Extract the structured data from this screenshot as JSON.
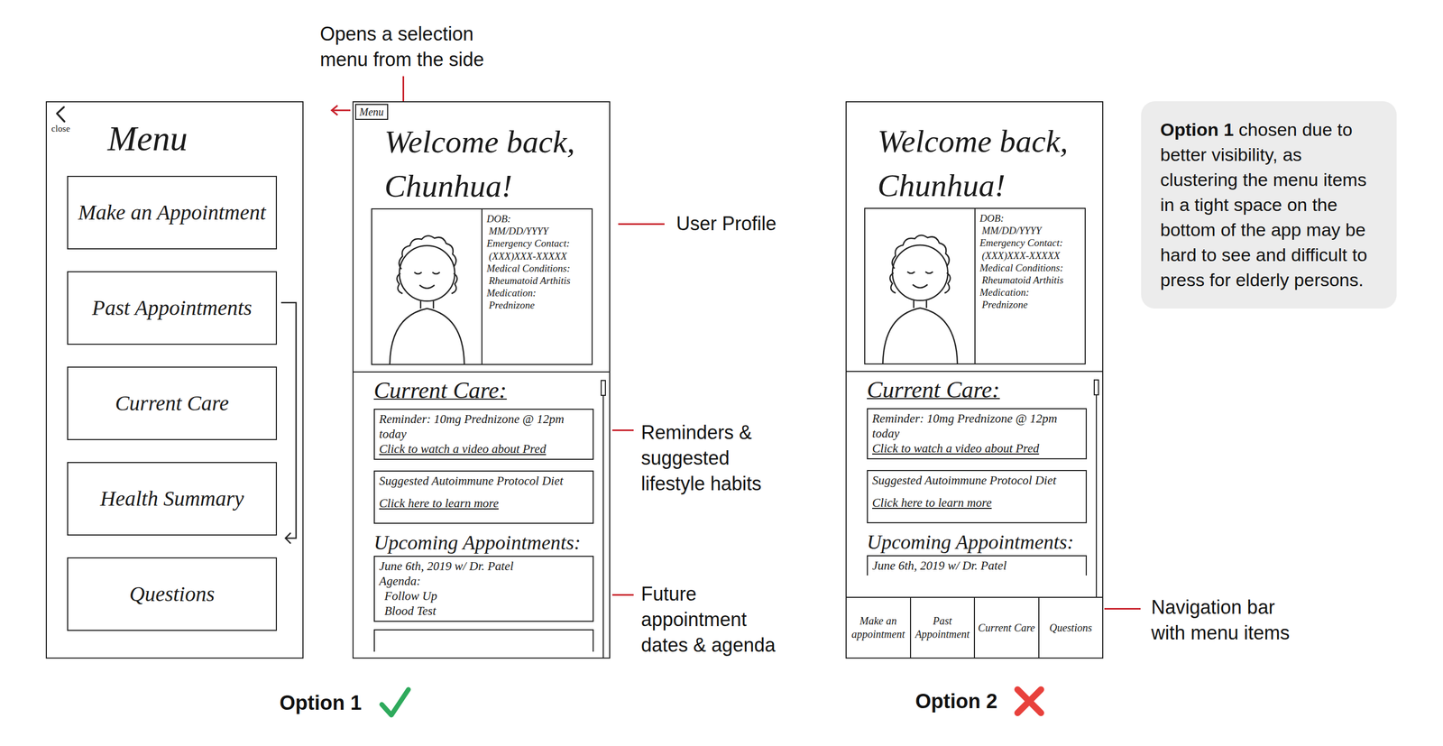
{
  "top_annotation": [
    "Opens a selection",
    "menu from the side"
  ],
  "menu_screen": {
    "close_label": "close",
    "title": "Menu",
    "items": [
      "Make an Appointment",
      "Past Appointments",
      "Current Care",
      "Health Summary",
      "Questions"
    ]
  },
  "screens": [
    {
      "menu_button": "Menu",
      "greeting": [
        "Welcome back,",
        "Chunhua!"
      ],
      "profile": [
        {
          "label": "DOB:",
          "value": "MM/DD/YYYY"
        },
        {
          "label": "Emergency Contact:",
          "value": "(XXX)XXX-XXXXX"
        },
        {
          "label": "Medical Conditions:",
          "value": "Rheumatoid Arthitis"
        },
        {
          "label": "Medication:",
          "value": "Prednizone"
        }
      ],
      "current_care_title": "Current Care:",
      "reminder": {
        "text": "Reminder: 10mg Prednizone @ 12pm today",
        "link": "Click to watch a video about Pred"
      },
      "diet": {
        "text": "Suggested Autoimmune Protocol Diet",
        "link": "Click here to learn more"
      },
      "upcoming_title": "Upcoming Appointments:",
      "appointment": {
        "date": "June 6th, 2019 w/ Dr. Patel",
        "agenda_label": "Agenda:",
        "agenda": [
          "Follow Up",
          "Blood Test"
        ]
      }
    },
    {
      "greeting": [
        "Welcome back,",
        "Chunhua!"
      ],
      "profile": [
        {
          "label": "DOB:",
          "value": "MM/DD/YYYY"
        },
        {
          "label": "Emergency Contact:",
          "value": "(XXX)XXX-XXXXX"
        },
        {
          "label": "Medical Conditions:",
          "value": "Rheumatoid Arthitis"
        },
        {
          "label": "Medication:",
          "value": "Prednizone"
        }
      ],
      "current_care_title": "Current Care:",
      "reminder": {
        "text": "Reminder: 10mg Prednizone @ 12pm today",
        "link": "Click to watch a video about Pred"
      },
      "diet": {
        "text": "Suggested Autoimmune Protocol Diet",
        "link": "Click here to learn more"
      },
      "upcoming_title": "Upcoming Appointments:",
      "appointment": {
        "date": "June 6th, 2019 w/ Dr. Patel"
      },
      "nav_items": [
        "Make an appointment",
        "Past Appointment",
        "Current Care",
        "Questions"
      ]
    }
  ],
  "labels": {
    "user_profile": [
      "User Profile"
    ],
    "reminders": [
      "Reminders &",
      "suggested",
      "lifestyle habits"
    ],
    "appointments": [
      "Future",
      "appointment",
      "dates & agenda"
    ],
    "nav_bar": [
      "Navigation bar",
      "with menu items"
    ]
  },
  "options": [
    {
      "label": "Option 1",
      "chosen": true
    },
    {
      "label": "Option 2",
      "chosen": false
    }
  ],
  "callout": {
    "bold": "Option 1",
    "text": " chosen due to better visibility, as clustering the menu items in a tight space on the bottom of the app may be hard to see and difficult to press for elderly persons."
  }
}
